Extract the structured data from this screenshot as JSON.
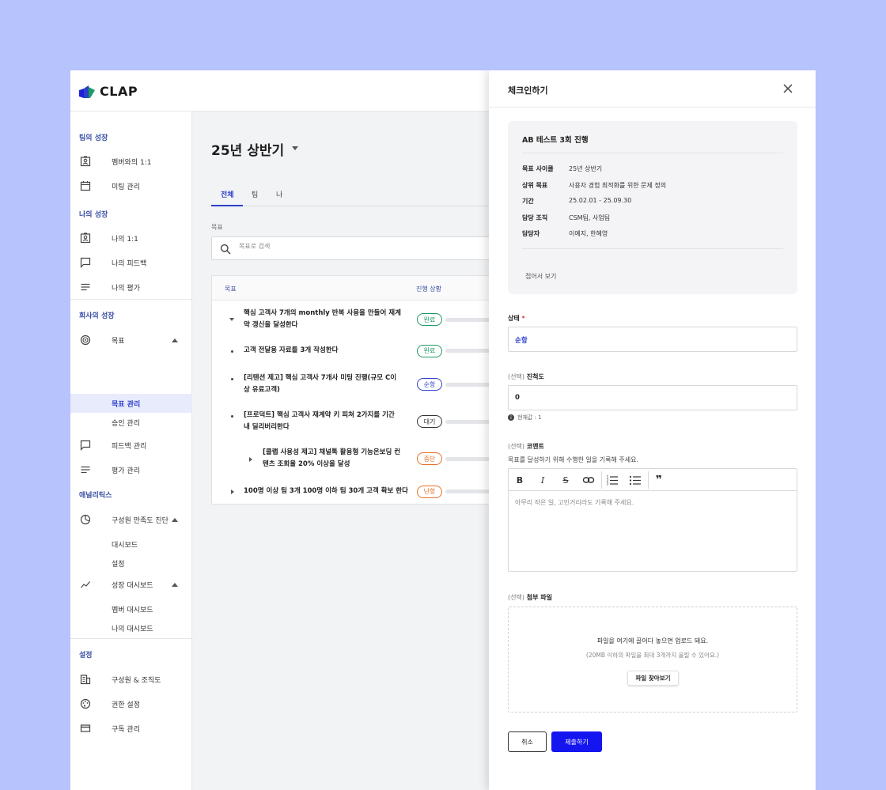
{
  "app": {
    "logo_text": "CLAP"
  },
  "sidebar": {
    "sections": [
      {
        "title": "팀의 성장"
      },
      {
        "title": "나의 성장"
      },
      {
        "title": "회사의 성장"
      },
      {
        "title": "애널리틱스"
      },
      {
        "title": "설정"
      }
    ],
    "items": {
      "member_1on1": "멤버와의 1:1",
      "meeting": "미팅 관리",
      "my_1on1": "나의 1:1",
      "my_feedback": "나의 피드백",
      "my_eval": "나의 평가",
      "goals": "목표",
      "goal_manage": "목표 관리",
      "approval": "승인 관리",
      "feedback_manage": "피드백 관리",
      "eval_manage": "평가 관리",
      "satisfaction": "구성원 만족도 진단",
      "dashboard": "대시보드",
      "settings_sub": "설정",
      "growth_dashboard": "성장 대시보드",
      "member_dashboard": "멤버 대시보드",
      "my_dashboard": "나의 대시보드",
      "org": "구성원 & 조직도",
      "permissions": "권한 설정",
      "subscription": "구독 관리"
    }
  },
  "main": {
    "period": "25년 상반기",
    "tabs": [
      "전체",
      "팀",
      "나"
    ],
    "search_label": "목표",
    "search_placeholder": "목표로 검색",
    "table_headers": [
      "목표",
      "진행 상황"
    ],
    "rows": [
      {
        "text": "핵심 고객사 7개의 monthly 반복 사용을 만들어 재계약 갱신을 달성한다",
        "status": "완료",
        "progress": 0.3
      },
      {
        "text": "고객 전달용 자료를 3개 작성한다",
        "status": "완료",
        "progress": 0.3
      },
      {
        "text": "[리텐션 제고] 핵심 고객사 7개사 미팅 진행(규모 C이상 유료고객)",
        "status": "순항",
        "progress": 0.3
      },
      {
        "text": "[프로덕트] 핵심 고객사 재계약 키 피쳐 2가지를 기간 내 딜리버리한다",
        "status": "대기",
        "progress": 0.3
      },
      {
        "text": "[클랩 사용성 제고] 채널톡 활용형 기능온보딩 컨텐츠 조회율 20% 이상을 달성",
        "status": "중단",
        "progress": 0.3
      },
      {
        "text": "100명 이상 팀 3개 100명 이하 팀 30개 고객 확보 한다",
        "status": "난항",
        "progress": 0.3
      }
    ],
    "status_colors": {
      "완료": "#1f9a63",
      "순항": "#2b3fcc",
      "대기": "#333333",
      "중단": "#e8702a",
      "난항": "#e8702a"
    }
  },
  "panel": {
    "title": "체크인하기",
    "card": {
      "title": "AB 테스트 3회 진행",
      "rows": [
        {
          "k": "목표 사이클",
          "v": "25년 상반기"
        },
        {
          "k": "상위 목표",
          "v": "사용자 경험 최적화를 위한 문제 정의"
        },
        {
          "k": "기간",
          "v": "25.02.01 - 25.09.30"
        },
        {
          "k": "담당 조직",
          "v": "CSM팀, 사업팀"
        },
        {
          "k": "담당자",
          "v": "이예지, 한혜영"
        }
      ],
      "collapse": "접어서 보기"
    },
    "status_label": "상태",
    "required_mark": "*",
    "status_value": "순항",
    "optional": "(선택)",
    "progress_label": "진척도",
    "progress_value": "0",
    "progress_hint": "현재값 : 1",
    "comment_label": "코멘트",
    "comment_desc": "목표를 달성하기 위해 수행한 일을 기록해 주세요.",
    "comment_placeholder": "아무리 작은 일, 고민거리라도 기록해 주세요.",
    "file_label": "첨부 파일",
    "drop_text": "파일을 여기에 끌어다 놓으면 업로드 돼요.",
    "drop_subtext": "(20MB 이하의 파일을 최대 3개까지 올릴 수 있어요.)",
    "find_button": "파일 찾아보기",
    "cancel_button": "취소",
    "submit_button": "제출하기",
    "status_color": "#2b3fcc",
    "accent": "#1515f0"
  }
}
